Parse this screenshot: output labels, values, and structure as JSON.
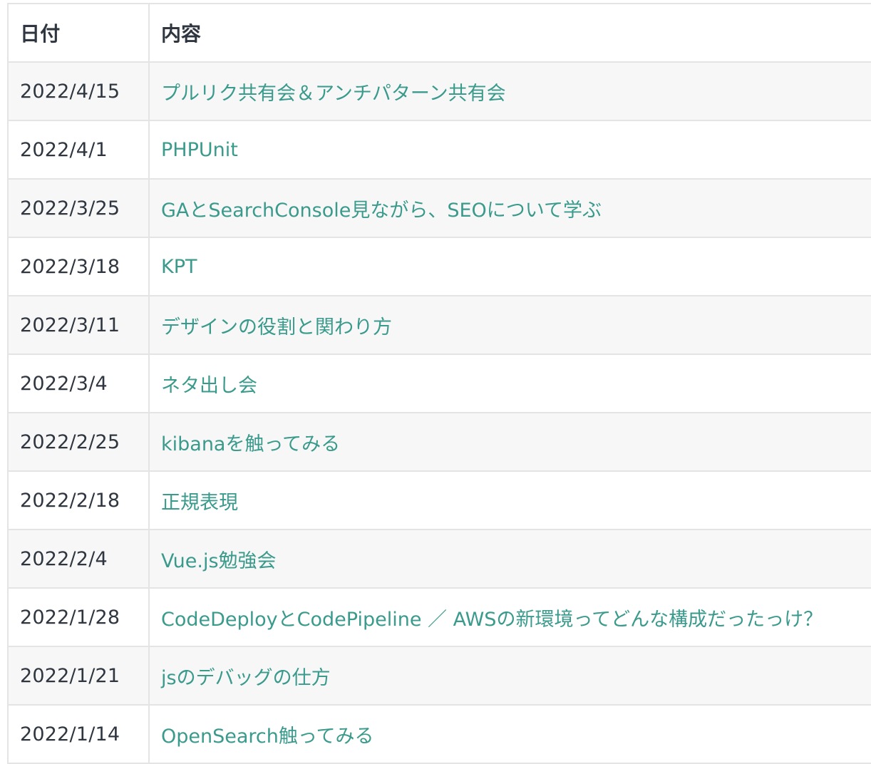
{
  "table": {
    "headers": {
      "date": "日付",
      "content": "内容"
    },
    "rows": [
      {
        "date": "2022/4/15",
        "title": "プルリク共有会＆アンチパターン共有会"
      },
      {
        "date": "2022/4/1",
        "title": "PHPUnit"
      },
      {
        "date": "2022/3/25",
        "title": "GAとSearchConsole見ながら、SEOについて学ぶ"
      },
      {
        "date": "2022/3/18",
        "title": "KPT"
      },
      {
        "date": "2022/3/11",
        "title": "デザインの役割と関わり方"
      },
      {
        "date": "2022/3/4",
        "title": "ネタ出し会"
      },
      {
        "date": "2022/2/25",
        "title": "kibanaを触ってみる"
      },
      {
        "date": "2022/2/18",
        "title": "正規表現"
      },
      {
        "date": "2022/2/4",
        "title": "Vue.js勉強会"
      },
      {
        "date": "2022/1/28",
        "title": "CodeDeployとCodePipeline ／ AWSの新環境ってどんな構成だったっけ？"
      },
      {
        "date": "2022/1/21",
        "title": "jsのデバッグの仕方"
      },
      {
        "date": "2022/1/14",
        "title": "OpenSearch触ってみる"
      }
    ]
  },
  "colors": {
    "link": "#3a9a8c",
    "text": "#2f3640",
    "zebra": "#f7f7f7",
    "border": "#e4e4e4"
  }
}
